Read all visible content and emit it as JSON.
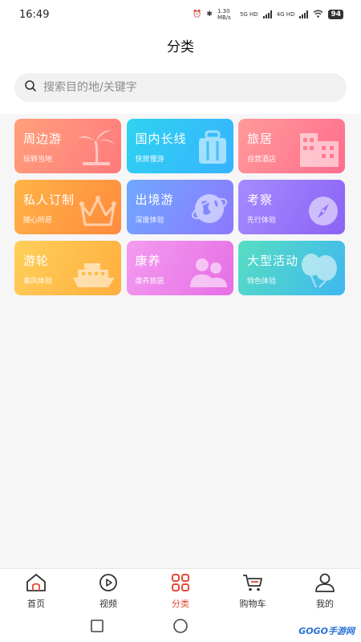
{
  "status": {
    "time": "16:49",
    "speed": "1.30 MB/s",
    "net1": "5G HD",
    "net2": "4G HD",
    "battery": "94"
  },
  "header": {
    "title": "分类"
  },
  "search": {
    "placeholder": "搜索目的地/关键字"
  },
  "categories": [
    {
      "title": "周边游",
      "subtitle": "玩转当地",
      "icon": "palm-tree-icon"
    },
    {
      "title": "国内长线",
      "subtitle": "快旅慢游",
      "icon": "luggage-icon"
    },
    {
      "title": "旅居",
      "subtitle": "自营酒店",
      "icon": "building-icon"
    },
    {
      "title": "私人订制",
      "subtitle": "随心所愿",
      "icon": "crown-icon"
    },
    {
      "title": "出境游",
      "subtitle": "深度体验",
      "icon": "globe-icon"
    },
    {
      "title": "考察",
      "subtitle": "先行体验",
      "icon": "compass-icon"
    },
    {
      "title": "游轮",
      "subtitle": "乘风体验",
      "icon": "ship-icon"
    },
    {
      "title": "康养",
      "subtitle": "康养旅居",
      "icon": "people-icon"
    },
    {
      "title": "大型活动",
      "subtitle": "特色体验",
      "icon": "balloon-icon"
    }
  ],
  "nav": {
    "items": [
      {
        "label": "首页",
        "icon": "home-icon"
      },
      {
        "label": "视频",
        "icon": "video-icon"
      },
      {
        "label": "分类",
        "icon": "category-icon",
        "active": true
      },
      {
        "label": "购物车",
        "icon": "cart-icon"
      },
      {
        "label": "我的",
        "icon": "user-icon"
      }
    ]
  },
  "watermark": "GOGO手游网",
  "colors": {
    "accent": "#e24a35"
  }
}
